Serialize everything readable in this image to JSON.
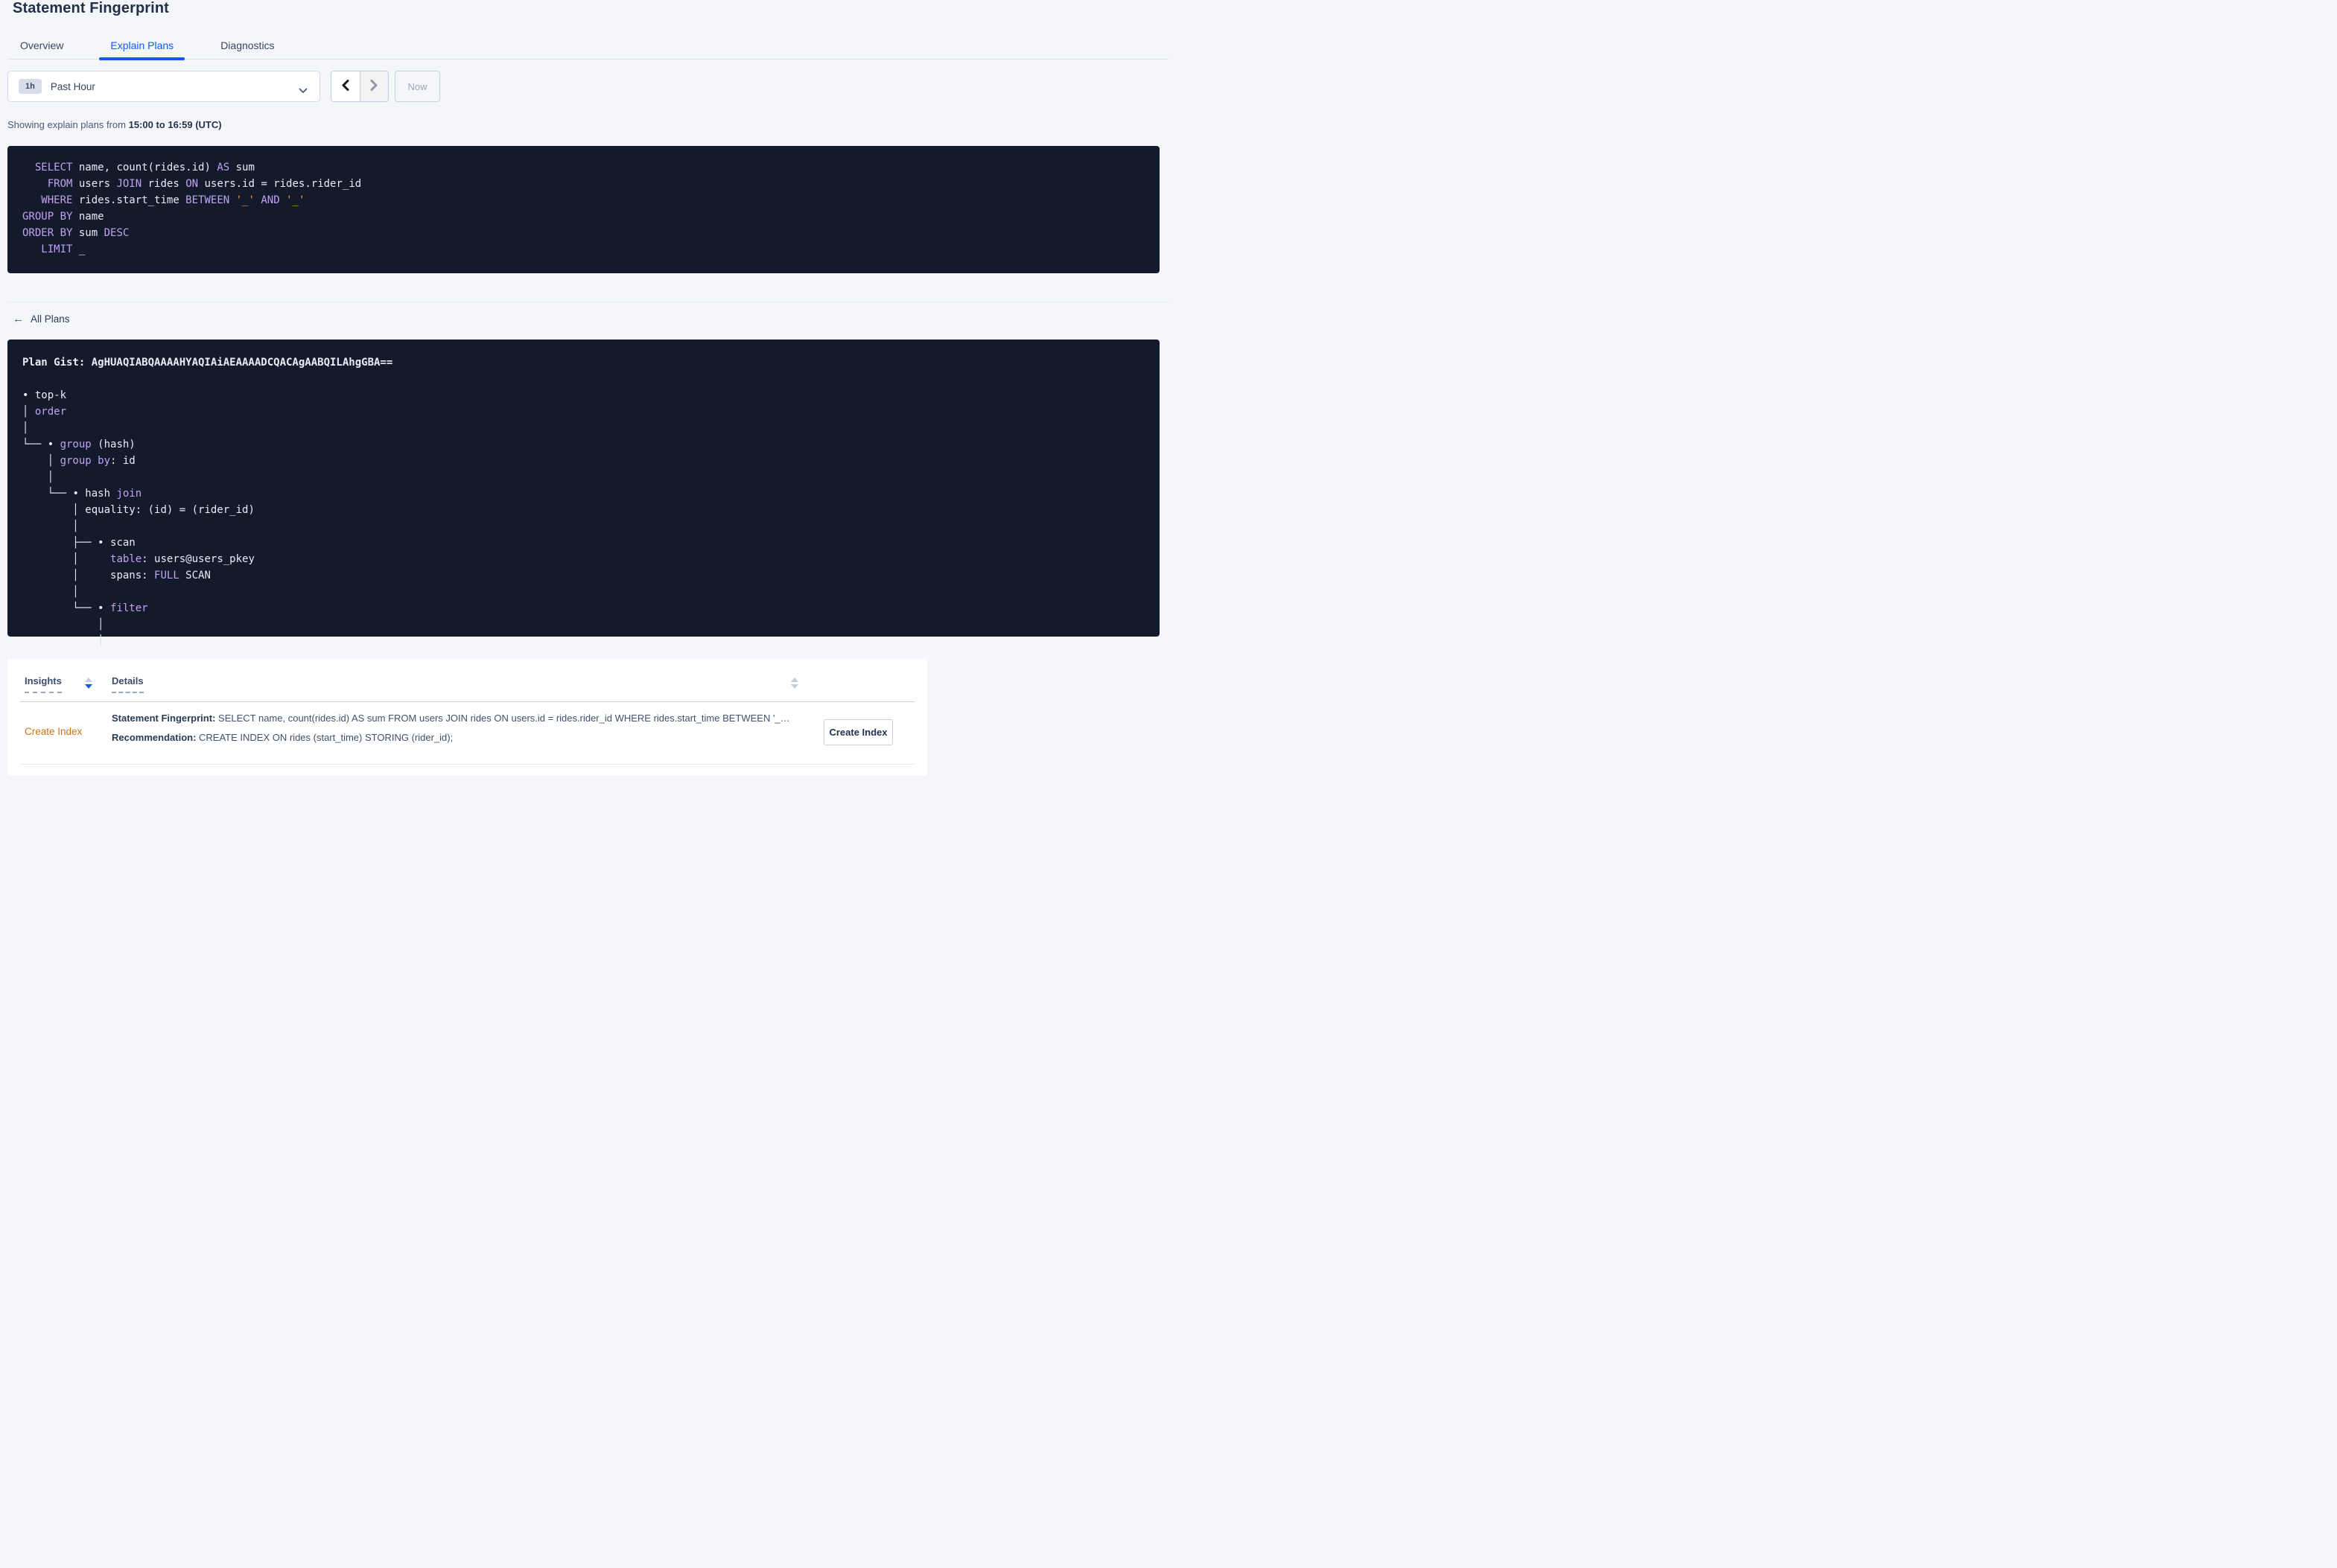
{
  "page": {
    "title": "Statement Fingerprint"
  },
  "tabs": [
    {
      "label": "Overview",
      "active": false
    },
    {
      "label": "Explain Plans",
      "active": true
    },
    {
      "label": "Diagnostics",
      "active": false
    }
  ],
  "time_controls": {
    "range_badge": "1h",
    "range_label": "Past Hour",
    "now_label": "Now"
  },
  "subtitle": {
    "prefix": "Showing explain plans from ",
    "bold": "15:00 to 16:59 (UTC)"
  },
  "sql_block": {
    "lines": [
      [
        [
          "id",
          "  "
        ],
        [
          "kw",
          "SELECT"
        ],
        [
          "id",
          " name, count(rides.id) "
        ],
        [
          "kw",
          "AS"
        ],
        [
          "id",
          " sum"
        ]
      ],
      [
        [
          "id",
          "    "
        ],
        [
          "kw",
          "FROM"
        ],
        [
          "id",
          " users "
        ],
        [
          "kw",
          "JOIN"
        ],
        [
          "id",
          " rides "
        ],
        [
          "kw",
          "ON"
        ],
        [
          "id",
          " users.id = rides.rider_id"
        ]
      ],
      [
        [
          "id",
          "   "
        ],
        [
          "kw",
          "WHERE"
        ],
        [
          "id",
          " rides.start_time "
        ],
        [
          "kw",
          "BETWEEN"
        ],
        [
          "id",
          " "
        ],
        [
          "lit",
          "'_'"
        ],
        [
          "id",
          " "
        ],
        [
          "kw",
          "AND"
        ],
        [
          "id",
          " "
        ],
        [
          "lit",
          "'_'"
        ]
      ],
      [
        [
          "kw",
          "GROUP BY"
        ],
        [
          "id",
          " name"
        ]
      ],
      [
        [
          "kw",
          "ORDER BY"
        ],
        [
          "id",
          " sum "
        ],
        [
          "kw",
          "DESC"
        ]
      ],
      [
        [
          "id",
          "   "
        ],
        [
          "kw",
          "LIMIT"
        ],
        [
          "id",
          " _"
        ]
      ]
    ]
  },
  "back_link": {
    "label": "All Plans"
  },
  "plan_block": {
    "lines": [
      [
        [
          "gist",
          "Plan Gist: AgHUAQIABQAAAAHYAQIAiAEAAAADCQACAgAABQILAhgGBA=="
        ]
      ],
      [],
      [
        [
          "id",
          "• top-k"
        ]
      ],
      [
        [
          "tree",
          "│ "
        ],
        [
          "kw",
          "order"
        ]
      ],
      [
        [
          "tree",
          "│"
        ]
      ],
      [
        [
          "tree",
          "└── "
        ],
        [
          "id",
          "• "
        ],
        [
          "kw",
          "group"
        ],
        [
          "id",
          " (hash)"
        ]
      ],
      [
        [
          "tree",
          "    │ "
        ],
        [
          "kw",
          "group by"
        ],
        [
          "id",
          ": id"
        ]
      ],
      [
        [
          "tree",
          "    │"
        ]
      ],
      [
        [
          "tree",
          "    └── "
        ],
        [
          "id",
          "• hash "
        ],
        [
          "kw",
          "join"
        ]
      ],
      [
        [
          "tree",
          "        │ "
        ],
        [
          "id",
          "equality: (id) = (rider_id)"
        ]
      ],
      [
        [
          "tree",
          "        │"
        ]
      ],
      [
        [
          "tree",
          "        ├── "
        ],
        [
          "id",
          "• scan"
        ]
      ],
      [
        [
          "tree",
          "        │     "
        ],
        [
          "kw",
          "table"
        ],
        [
          "id",
          ": users@users_pkey"
        ]
      ],
      [
        [
          "tree",
          "        │     "
        ],
        [
          "id",
          "spans: "
        ],
        [
          "kw",
          "FULL"
        ],
        [
          "id",
          " SCAN"
        ]
      ],
      [
        [
          "tree",
          "        │"
        ]
      ],
      [
        [
          "tree",
          "        └── "
        ],
        [
          "id",
          "• "
        ],
        [
          "kw",
          "filter"
        ]
      ],
      [
        [
          "tree",
          "            │"
        ]
      ],
      [
        [
          "tree",
          "            │"
        ]
      ]
    ]
  },
  "insights_table": {
    "columns": [
      {
        "label": "Insights"
      },
      {
        "label": "Details"
      }
    ],
    "row": {
      "insight": "Create Index",
      "fingerprint_label": "Statement Fingerprint:",
      "fingerprint_text": " SELECT name, count(rides.id) AS sum FROM users JOIN rides ON users.id = rides.rider_id WHERE rides.start_time BETWEEN '_…",
      "recommendation_label": "Recommendation:",
      "recommendation_text": " CREATE INDEX ON rides (start_time) STORING (rider_id);",
      "action_label": "Create Index"
    }
  },
  "icons": {
    "prev": "chevron-left-icon",
    "next": "chevron-right-icon",
    "dropdown": "chevron-down-icon",
    "back": "arrow-left-icon",
    "sort": "sort-arrows-icon"
  },
  "colors": {
    "accent_blue": "#1458f0",
    "code_background": "#131a2c",
    "code_keyword": "#c2a2f0",
    "code_literal": "#eea33e",
    "code_text": "#e9ecf5",
    "insight_link": "#c8750f",
    "page_background": "#f5f6fa"
  }
}
